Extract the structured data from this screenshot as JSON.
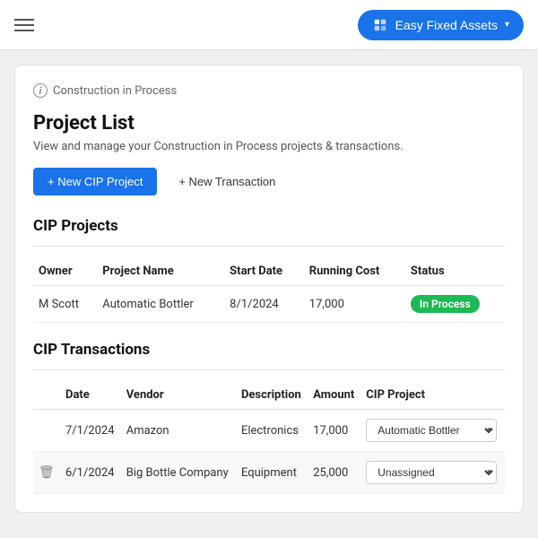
{
  "topBar": {
    "appButton": {
      "label": "Easy Fixed Assets",
      "chevron": "▾"
    }
  },
  "breadcrumb": {
    "icon": "i",
    "text": "Construction in Process"
  },
  "pageTitle": "Project List",
  "pageSubtitle": "View and manage your Construction in Process projects & transactions.",
  "buttons": {
    "newCIP": "+ New CIP Project",
    "newTransaction": "+ New Transaction"
  },
  "cipProjectsSection": {
    "title": "CIP Projects",
    "tableHeaders": [
      "Owner",
      "Project Name",
      "Start Date",
      "Running Cost",
      "Status"
    ],
    "rows": [
      {
        "owner": "M Scott",
        "projectName": "Automatic Bottler",
        "startDate": "8/1/2024",
        "runningCost": "17,000",
        "status": "In Process"
      }
    ]
  },
  "cipTransactionsSection": {
    "title": "CIP Transactions",
    "tableHeaders": [
      "Date",
      "Vendor",
      "Description",
      "Amount",
      "CIP Project"
    ],
    "rows": [
      {
        "date": "7/1/2024",
        "vendor": "Amazon",
        "description": "Electronics",
        "amount": "17,000",
        "cipProject": "Automatic Bottler",
        "hasTrash": false,
        "highlighted": false
      },
      {
        "date": "6/1/2024",
        "vendor": "Big Bottle Company",
        "description": "Equipment",
        "amount": "25,000",
        "cipProject": "Unassigned",
        "hasTrash": true,
        "highlighted": true
      }
    ]
  }
}
